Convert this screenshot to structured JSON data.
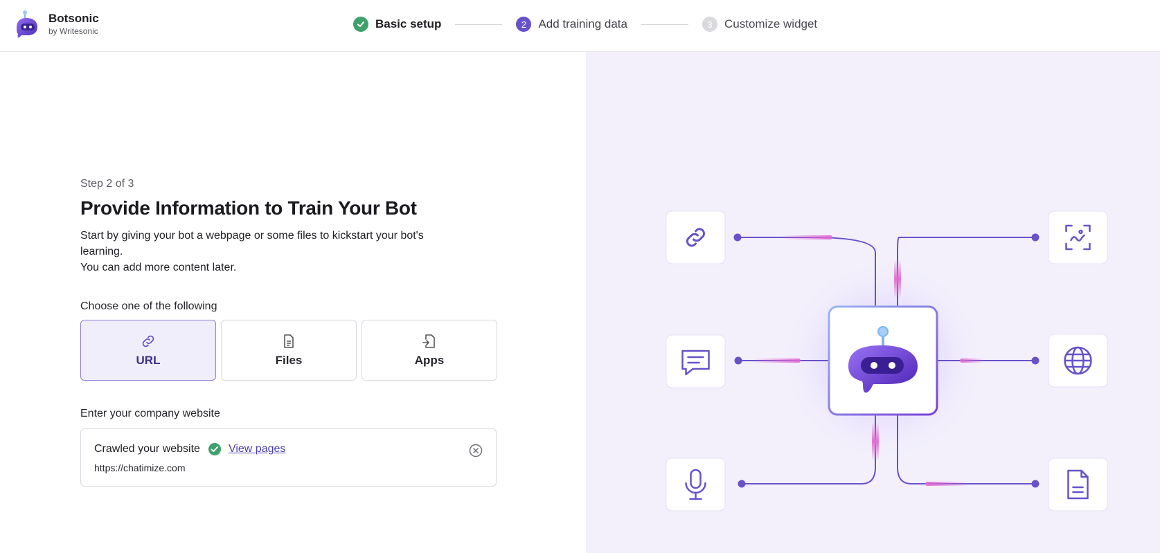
{
  "brand": {
    "name": "Botsonic",
    "sub": "by Writesonic",
    "logo_icon": "bot-logo-icon"
  },
  "steps": [
    {
      "badge": "✓",
      "label": "Basic setup",
      "state": "done"
    },
    {
      "badge": "2",
      "label": "Add training data",
      "state": "active"
    },
    {
      "badge": "3",
      "label": "Customize widget",
      "state": "pending"
    }
  ],
  "main": {
    "step_count": "Step 2 of 3",
    "title": "Provide Information to Train Your Bot",
    "description_line1": "Start by giving your bot a webpage or some files to kickstart your bot's learning.",
    "description_line2": "You can add more content later.",
    "choose_label": "Choose one of the following",
    "options": [
      {
        "label": "URL",
        "icon": "link-icon",
        "selected": true
      },
      {
        "label": "Files",
        "icon": "file-icon",
        "selected": false
      },
      {
        "label": "Apps",
        "icon": "file-import-icon",
        "selected": false
      }
    ],
    "website_label": "Enter your company website",
    "crawl": {
      "status_text": "Crawled your website",
      "view_pages": "View pages",
      "url": "https://chatimize.com"
    }
  },
  "illustration": {
    "nodes": [
      "link-icon",
      "scan-icon",
      "chat-icon",
      "globe-icon",
      "microphone-icon",
      "document-icon"
    ],
    "center": "bot-logo-icon"
  },
  "colors": {
    "accent": "#6752c9",
    "success": "#3fa16a",
    "panel_bg": "#f3f0fc",
    "pink_glow": "#e06ad2"
  }
}
